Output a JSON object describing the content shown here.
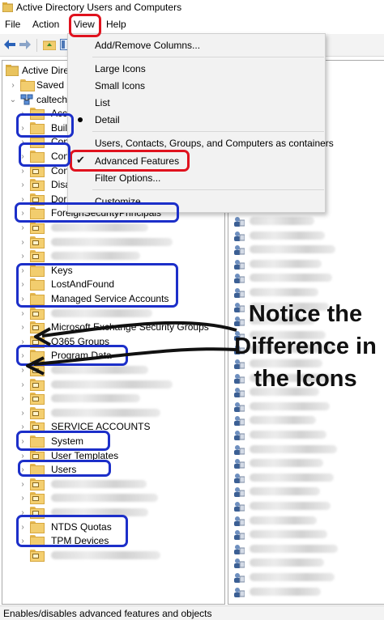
{
  "window": {
    "title": "Active Directory Users and Computers"
  },
  "menubar": {
    "items": [
      "File",
      "Action",
      "View",
      "Help"
    ]
  },
  "tree": {
    "root_label": "Active Directo",
    "rows": [
      {
        "label": "Saved Q",
        "icon": "folder",
        "chevron": true
      },
      {
        "label": "caltech",
        "icon": "domain",
        "chevron": "down"
      },
      {
        "label": "Acc",
        "icon": "folder",
        "chevron": true
      },
      {
        "label": "Buil",
        "icon": "folder",
        "chevron": true
      },
      {
        "label": "Con",
        "icon": "folder",
        "chevron": true
      },
      {
        "label": "Con",
        "icon": "folder",
        "chevron": true
      },
      {
        "label": "Con",
        "icon": "ou",
        "chevron": true
      },
      {
        "label": "Disa",
        "icon": "ou",
        "chevron": true
      },
      {
        "label": "Dor",
        "icon": "ou",
        "chevron": true
      },
      {
        "label": "ForeignSecurityPrincipals",
        "icon": "folder",
        "chevron": true
      },
      {
        "label": "",
        "icon": "ou",
        "chevron": true
      },
      {
        "label": "",
        "icon": "ou",
        "chevron": true
      },
      {
        "label": "",
        "icon": "ou",
        "chevron": true
      },
      {
        "label": "Keys",
        "icon": "folder",
        "chevron": true
      },
      {
        "label": "LostAndFound",
        "icon": "folder",
        "chevron": true
      },
      {
        "label": "Managed Service Accounts",
        "icon": "folder",
        "chevron": true
      },
      {
        "label": "",
        "icon": "ou",
        "chevron": true
      },
      {
        "label": "Microsoft Exchange Security Groups",
        "icon": "ou",
        "chevron": true
      },
      {
        "label": "O365 Groups",
        "icon": "ou",
        "chevron": true
      },
      {
        "label": "Program Data",
        "icon": "folder",
        "chevron": true
      },
      {
        "label": "",
        "icon": "ou",
        "chevron": true
      },
      {
        "label": "",
        "icon": "ou",
        "chevron": true
      },
      {
        "label": "",
        "icon": "ou",
        "chevron": true
      },
      {
        "label": "",
        "icon": "ou",
        "chevron": true
      },
      {
        "label": "SERVICE ACCOUNTS",
        "icon": "ou",
        "chevron": true
      },
      {
        "label": "System",
        "icon": "folder",
        "chevron": true
      },
      {
        "label": "User Templates",
        "icon": "ou",
        "chevron": true
      },
      {
        "label": "Users",
        "icon": "folder",
        "chevron": true
      },
      {
        "label": "",
        "icon": "ou",
        "chevron": true
      },
      {
        "label": "",
        "icon": "ou",
        "chevron": true
      },
      {
        "label": "",
        "icon": "ou",
        "chevron": true
      },
      {
        "label": "NTDS Quotas",
        "icon": "folder",
        "chevron": true
      },
      {
        "label": "TPM Devices",
        "icon": "folder",
        "chevron": true
      },
      {
        "label": "",
        "icon": "ou",
        "chevron": false
      }
    ]
  },
  "right_pane": {
    "item_icon": "user-icon"
  },
  "view_menu": {
    "items": [
      {
        "label": "Add/Remove Columns...",
        "mark": ""
      },
      {
        "label": "Large Icons",
        "mark": ""
      },
      {
        "label": "Small Icons",
        "mark": ""
      },
      {
        "label": "List",
        "mark": ""
      },
      {
        "label": "Detail",
        "mark": "bullet"
      },
      {
        "label": "Users, Contacts, Groups, and Computers as containers",
        "mark": ""
      },
      {
        "label": "Advanced Features",
        "mark": "check"
      },
      {
        "label": "Filter Options...",
        "mark": ""
      },
      {
        "label": "Customize...",
        "mark": ""
      }
    ]
  },
  "annotation": {
    "lines": [
      "Notice the",
      "Difference in",
      "the Icons"
    ]
  },
  "statusbar": {
    "text": "Enables/disables advanced features and objects"
  },
  "colors": {
    "highlight_blue": "#1c2fc9",
    "highlight_red": "#e0121e",
    "folder": "#f2cd6e"
  }
}
